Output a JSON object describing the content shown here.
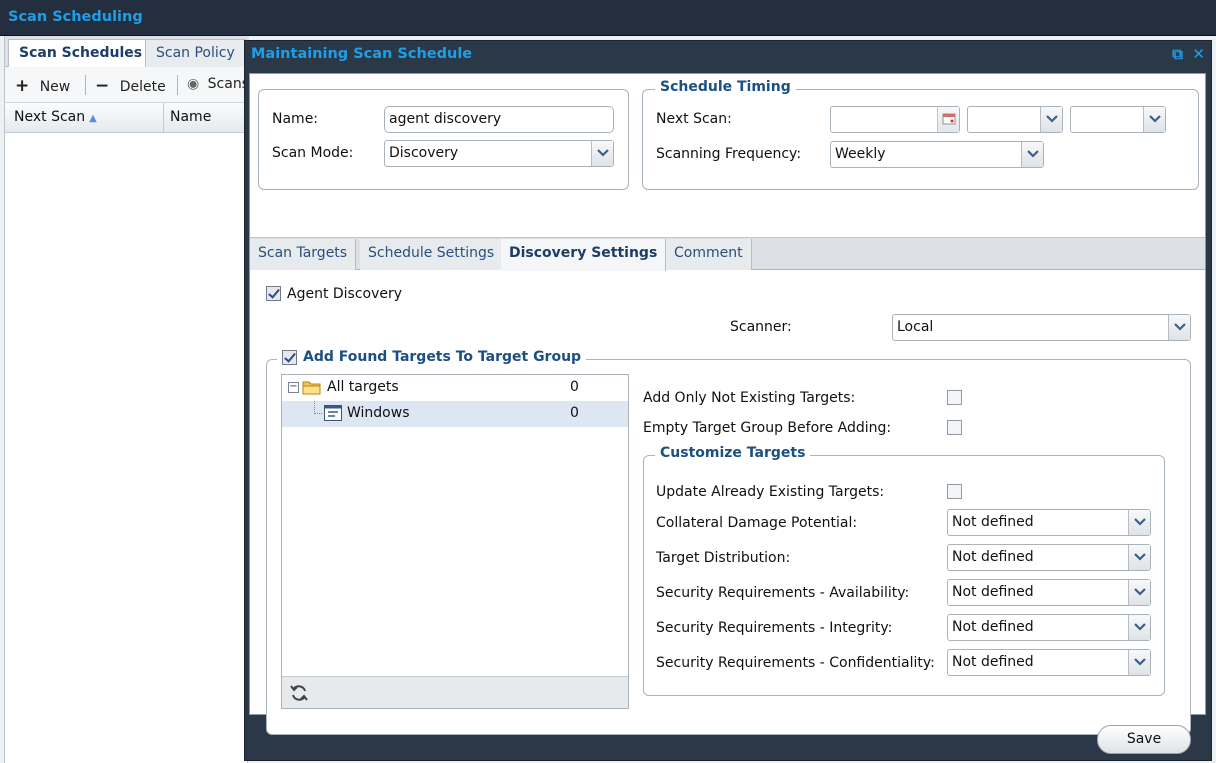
{
  "app": {
    "title": "Scan Scheduling"
  },
  "left_panel": {
    "tabs": [
      {
        "label": "Scan Schedules",
        "active": true
      },
      {
        "label": "Scan Policy",
        "active": false
      }
    ],
    "toolbar": {
      "new_label": "New",
      "delete_label": "Delete",
      "scans_label": "Scans"
    },
    "columns": [
      {
        "label": "Next Scan",
        "sorted": "asc"
      },
      {
        "label": "Name"
      }
    ]
  },
  "modal": {
    "title": "Maintaining Scan Schedule",
    "general": {
      "name_label": "Name:",
      "name_value": "agent discovery",
      "scan_mode_label": "Scan Mode:",
      "scan_mode_value": "Discovery"
    },
    "schedule_timing": {
      "legend": "Schedule Timing",
      "next_scan_label": "Next Scan:",
      "next_scan_date": "",
      "next_scan_hour": "",
      "next_scan_minute": "",
      "frequency_label": "Scanning Frequency:",
      "frequency_value": "Weekly"
    },
    "tabs": [
      {
        "label": "Scan Targets",
        "active": false
      },
      {
        "label": "Schedule Settings",
        "active": false
      },
      {
        "label": "Discovery Settings",
        "active": true
      },
      {
        "label": "Comment",
        "active": false
      }
    ],
    "discovery": {
      "agent_discovery_label": "Agent Discovery",
      "agent_discovery_checked": true,
      "scanner_label": "Scanner:",
      "scanner_value": "Local",
      "add_found_label": "Add Found Targets To Target Group",
      "add_found_checked": true,
      "tree": [
        {
          "label": "All targets",
          "count": "0",
          "level": 0,
          "selected": false
        },
        {
          "label": "Windows",
          "count": "0",
          "level": 1,
          "selected": true
        }
      ],
      "add_only_not_existing_label": "Add Only Not Existing Targets:",
      "add_only_not_existing_checked": false,
      "empty_group_label": "Empty Target Group Before Adding:",
      "empty_group_checked": false,
      "customize": {
        "legend": "Customize Targets",
        "update_existing_label": "Update Already Existing Targets:",
        "update_existing_checked": false,
        "fields": [
          {
            "label": "Collateral Damage Potential:",
            "value": "Not defined"
          },
          {
            "label": "Target Distribution:",
            "value": "Not defined"
          },
          {
            "label": "Security Requirements - Availability:",
            "value": "Not defined"
          },
          {
            "label": "Security Requirements - Integrity:",
            "value": "Not defined"
          },
          {
            "label": "Security Requirements - Confidentiality:",
            "value": "Not defined"
          }
        ]
      }
    },
    "footer": {
      "save_label": "Save"
    }
  },
  "colors": {
    "accent": "#1f9ee8",
    "titlebar": "#232f3e",
    "legend": "#1c4f82"
  }
}
